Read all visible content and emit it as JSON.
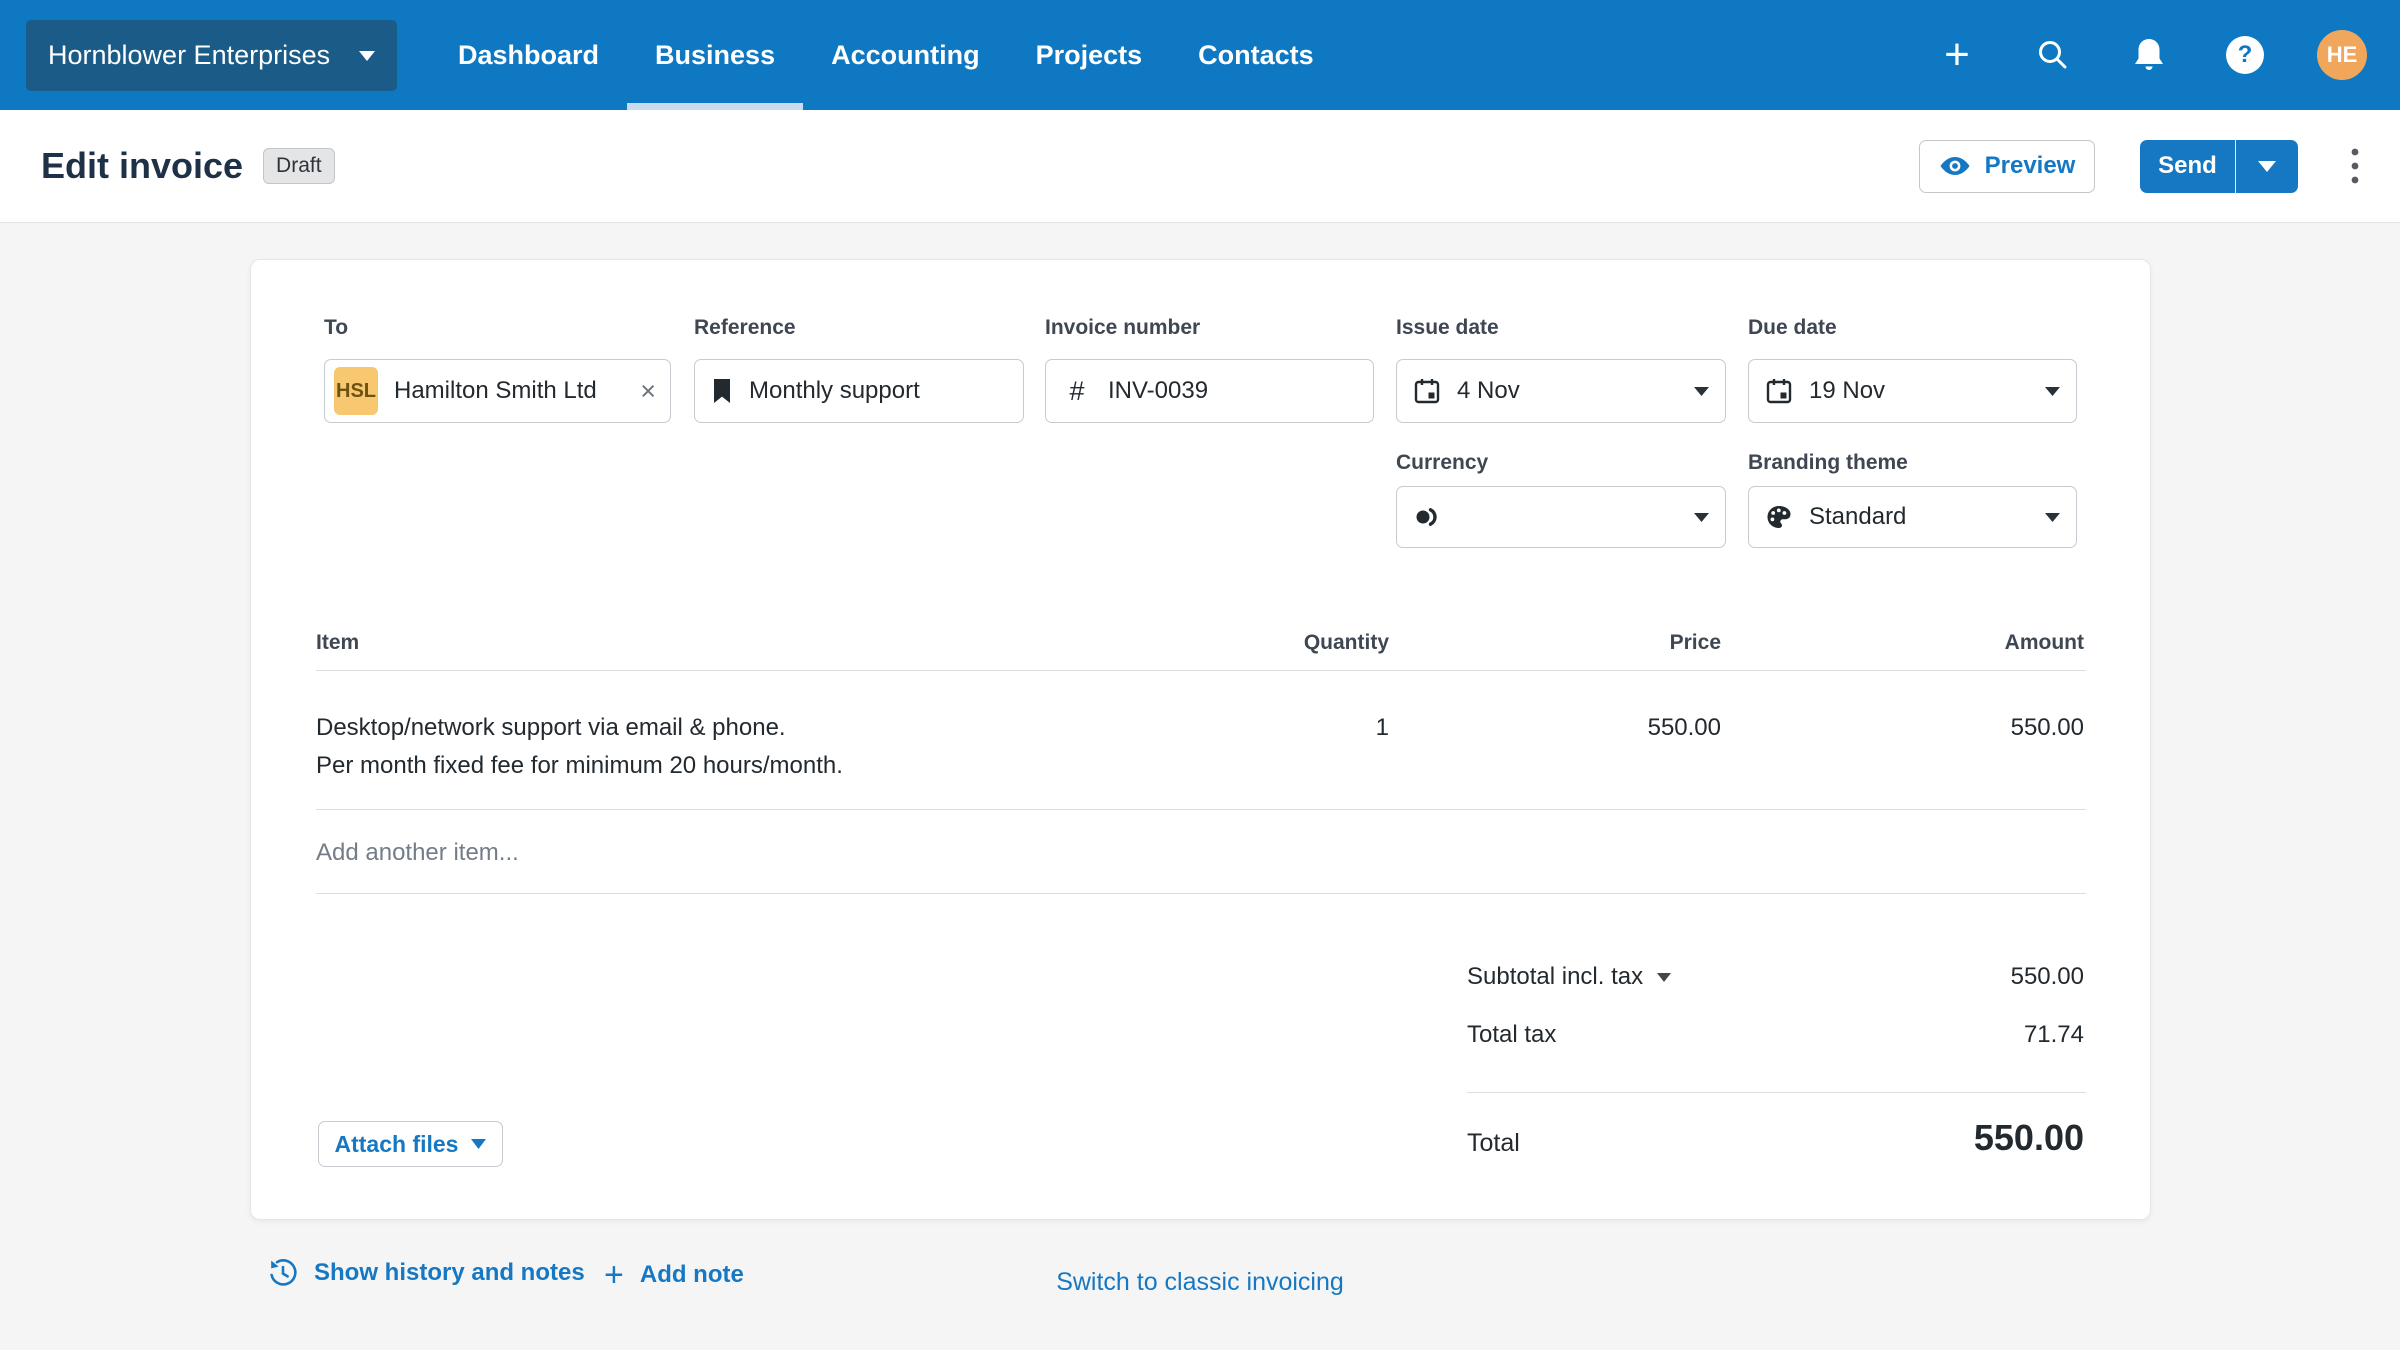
{
  "nav": {
    "org_name": "Hornblower Enterprises",
    "tabs": [
      "Dashboard",
      "Business",
      "Accounting",
      "Projects",
      "Contacts"
    ],
    "active_tab": "Business",
    "avatar_initials": "HE",
    "plus_glyph": "+",
    "help_glyph": "?"
  },
  "header": {
    "title": "Edit invoice",
    "status_badge": "Draft",
    "preview_label": "Preview",
    "send_label": "Send"
  },
  "form": {
    "to": {
      "label": "To",
      "chip": "HSL",
      "value": "Hamilton Smith Ltd",
      "remove_glyph": "×"
    },
    "reference": {
      "label": "Reference",
      "value": "Monthly support"
    },
    "invoice_number": {
      "label": "Invoice number",
      "hash_glyph": "#",
      "value": "INV-0039"
    },
    "issue_date": {
      "label": "Issue date",
      "value": "4 Nov"
    },
    "due_date": {
      "label": "Due date",
      "value": "19 Nov"
    },
    "currency": {
      "label": "Currency"
    },
    "branding_theme": {
      "label": "Branding theme",
      "value": "Standard"
    }
  },
  "items_table": {
    "headers": {
      "item": "Item",
      "quantity": "Quantity",
      "price": "Price",
      "amount": "Amount"
    },
    "rows": [
      {
        "description_line1": "Desktop/network support via email & phone.",
        "description_line2": "Per month fixed fee for minimum 20 hours/month.",
        "quantity": "1",
        "price": "550.00",
        "amount": "550.00"
      }
    ],
    "add_item_placeholder": "Add another item..."
  },
  "totals": {
    "subtotal_label": "Subtotal incl. tax",
    "subtotal_value": "550.00",
    "tax_label": "Total tax",
    "tax_value": "71.74",
    "total_label": "Total",
    "total_value": "550.00"
  },
  "actions": {
    "attach_files_label": "Attach files",
    "show_history_label": "Show history and notes",
    "add_note_glyph": "+",
    "add_note_label": "Add note",
    "switch_link": "Switch to classic invoicing"
  },
  "colors": {
    "nav_bg": "#0E78C2",
    "nav_active_underline": "#C7DCEE",
    "org_bg": "#1B5B87",
    "accent_blue": "#1678C2",
    "avatar_bg": "#F0A75C",
    "chip_bg": "#F8C871",
    "status_badge_bg": "#E4E5E7",
    "page_bg": "#F5F5F6"
  }
}
